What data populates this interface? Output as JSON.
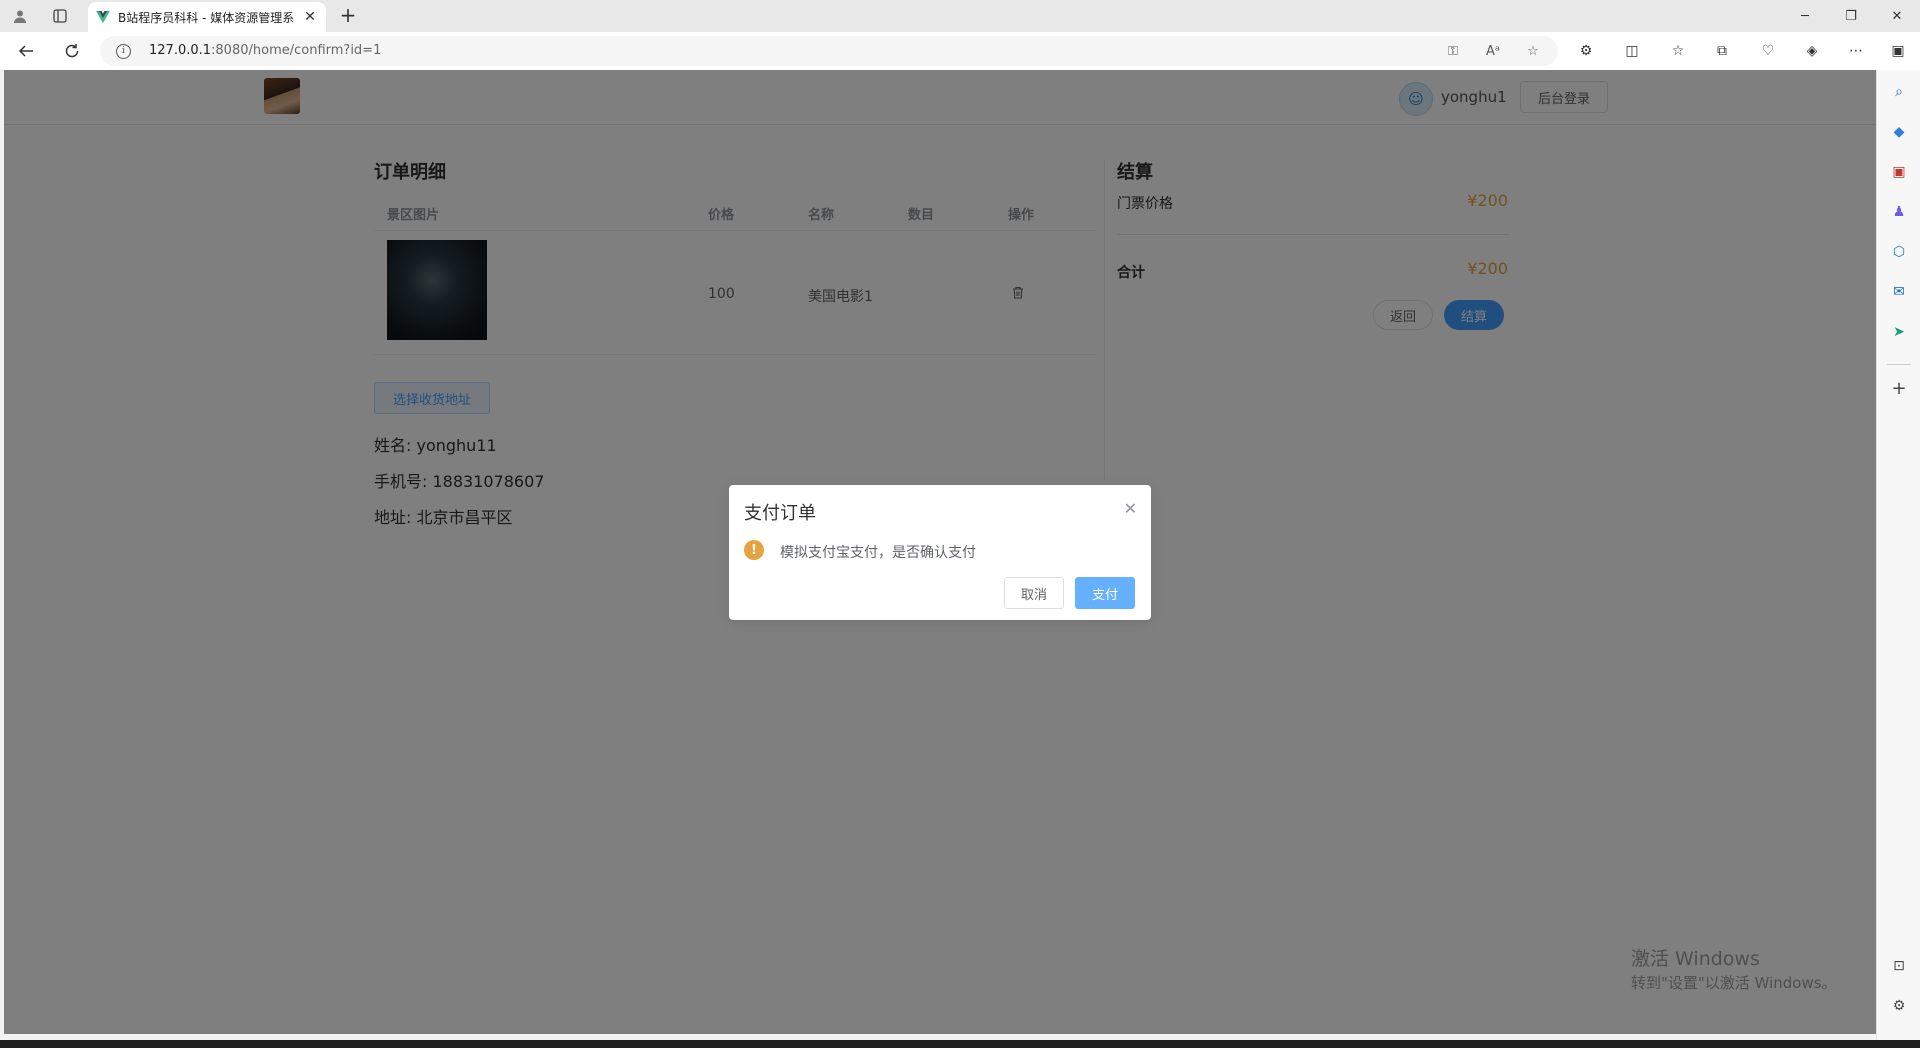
{
  "browser": {
    "tab_title": "B站程序员科科 - 媒体资源管理系",
    "url_host": "127.0.0.1",
    "url_rest": ":8080/home/confirm?id=1"
  },
  "header": {
    "username": "yonghu1",
    "admin_login": "后台登录"
  },
  "order": {
    "title": "订单明细",
    "columns": [
      "景区图片",
      "价格",
      "名称",
      "数目",
      "操作"
    ],
    "rows": [
      {
        "price": "100",
        "name": "美国电影1",
        "quantity": ""
      }
    ],
    "address_button": "选择收货地址",
    "name_line": "姓名: yonghu11",
    "phone_line": "手机号: 18831078607",
    "address_line": "地址: 北京市昌平区"
  },
  "summary": {
    "title": "结算",
    "ticket_label": "门票价格",
    "ticket_value": "¥200",
    "total_label": "合计",
    "total_value": "¥200",
    "back_button": "返回",
    "checkout_button": "结算"
  },
  "dialog": {
    "title": "支付订单",
    "message": "模拟支付宝支付，是否确认支付",
    "cancel": "取消",
    "confirm": "支付",
    "close_icon": "close-icon"
  },
  "watermark": {
    "line1": "激活 Windows",
    "line2": "转到\"设置\"以激活 Windows。"
  },
  "colors": {
    "primary": "#409eff",
    "warning": "#e6a23c",
    "price": "#e6a23c"
  }
}
